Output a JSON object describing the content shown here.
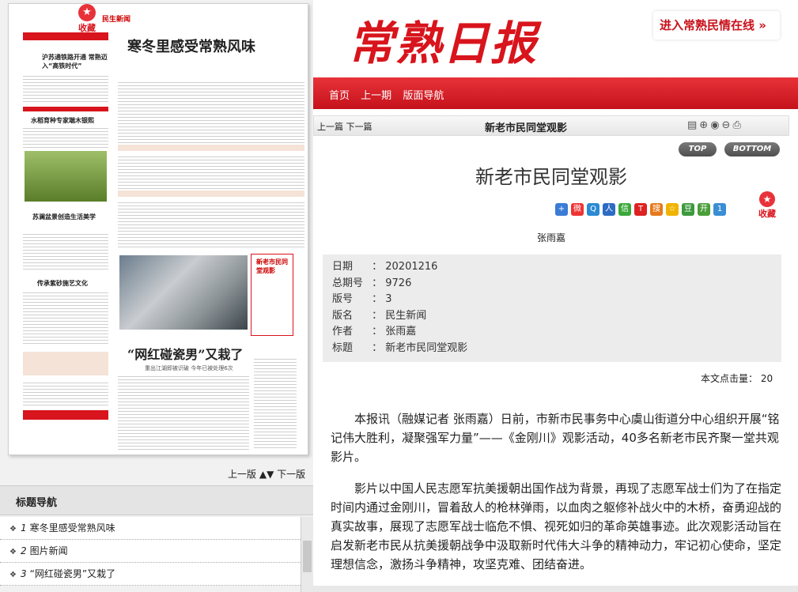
{
  "header": {
    "masthead": "常熟日报",
    "top_link": "进入常熟民情在线 »"
  },
  "nav": {
    "items": [
      "首页",
      "上一期",
      "版面导航"
    ]
  },
  "left": {
    "favorite_label": "收藏",
    "paper_section": "民生新闻",
    "paper_headline": "寒冬里感受常熟风味",
    "paper_headline2": "“网红碰瓷男”又栽了",
    "paper_subhead": "重出江湖即被识破 今年已被处理6次",
    "paper_side_headlines": [
      "沪苏通铁路开通 常熟迈入“高铁时代”",
      "水稻育种专家端木银熙",
      "苏澜盆景创造生活美学",
      "传承紫砂施艺文化",
      "新老市民同堂观影"
    ],
    "pager_prev": "上一版",
    "pager_next": "下一版",
    "toc_title": "标题导航",
    "toc_items": [
      {
        "num": "1",
        "title": "寒冬里感受常熟风味"
      },
      {
        "num": "2",
        "title": "图片新闻"
      },
      {
        "num": "3",
        "title": "“网红碰瓷男”又栽了"
      }
    ]
  },
  "article": {
    "prev_next": "上一篇 下一篇",
    "bar_title": "新老市民同堂观影",
    "top_btn": "TOP",
    "bottom_btn": "BOTTOM",
    "title": "新老市民同堂观影",
    "favorite_label": "收藏",
    "author": "张雨嘉",
    "meta": [
      {
        "k": "日期",
        "v": "20201216"
      },
      {
        "k": "总期号",
        "v": "9726"
      },
      {
        "k": "版号",
        "v": "3"
      },
      {
        "k": "版名",
        "v": "民生新闻"
      },
      {
        "k": "作者",
        "v": "张雨嘉"
      },
      {
        "k": "标题",
        "v": "新老市民同堂观影"
      }
    ],
    "clicks_label": "本文点击量：",
    "clicks_value": "20",
    "paragraphs": [
      "本报讯（融媒记者 张雨嘉）日前，市新市民事务中心虞山街道分中心组织开展“铭记伟大胜利，凝聚强军力量”——《金刚川》观影活动，40多名新老市民齐聚一堂共观影片。",
      "影片以中国人民志愿军抗美援朝出国作战为背景，再现了志愿军战士们为了在指定时间内通过金刚川，冒着敌人的枪林弹雨，以血肉之躯修补战火中的木桥，奋勇迎战的真实故事，展现了志愿军战士临危不惧、视死如归的革命英雄事迹。此次观影活动旨在启发新老市民从抗美援朝战争中汲取新时代伟大斗争的精神动力，牢记初心使命，坚定理想信念，激扬斗争精神，攻坚克难、团结奋进。"
    ]
  }
}
